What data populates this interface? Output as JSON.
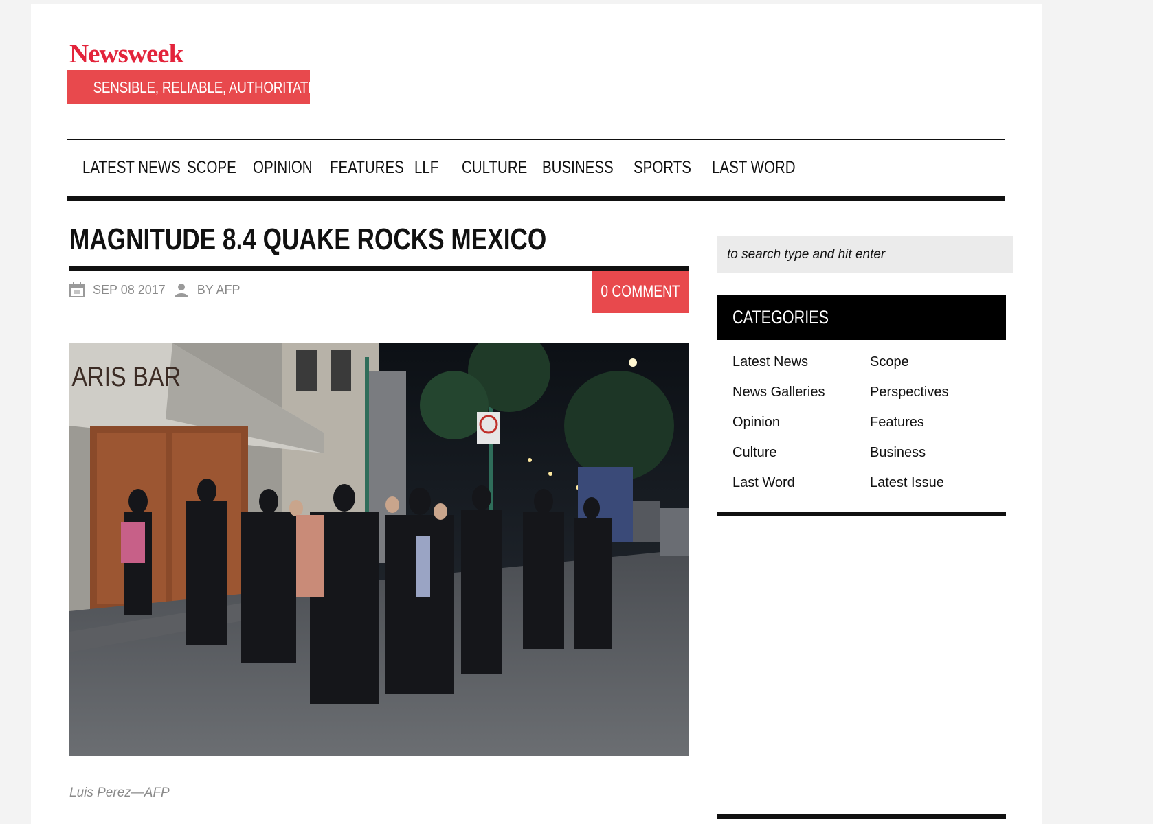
{
  "brand": {
    "logo": "Newsweek",
    "tagline": "SENSIBLE, RELIABLE, AUTHORITATIVE",
    "accent": "#e8494d",
    "logo_color": "#e3243b"
  },
  "nav": {
    "items": [
      "LATEST NEWS",
      "SCOPE",
      "OPINION",
      "FEATURES",
      "LLF",
      "CULTURE",
      "BUSINESS",
      "SPORTS",
      "LAST WORD"
    ]
  },
  "article": {
    "title": "MAGNITUDE 8.4 QUAKE ROCKS MEXICO",
    "date": "SEP 08 2017",
    "author": "BY AFP",
    "comment_label": "0 COMMENT",
    "photo_sign": "ARIS BAR",
    "caption": "Luis Perez—AFP",
    "calendar_icon": "calendar-icon",
    "author_icon": "user-icon"
  },
  "sidebar": {
    "search_placeholder": "to search type and hit enter",
    "categories_title": "CATEGORIES",
    "categories": [
      "Latest News",
      "Scope",
      "News Galleries",
      "Perspectives",
      "Opinion",
      "Features",
      "Culture",
      "Business",
      "Last Word",
      "Latest Issue"
    ]
  }
}
